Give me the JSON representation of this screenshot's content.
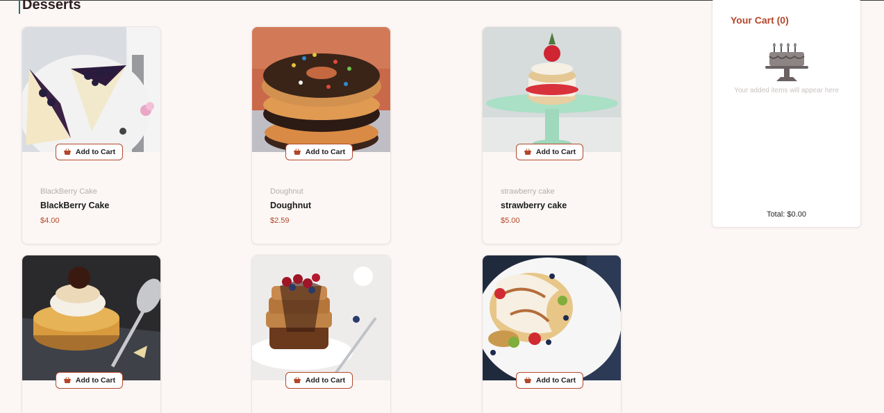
{
  "page": {
    "title": "Desserts"
  },
  "products": [
    {
      "category": "BlackBerry Cake",
      "name": "BlackBerry Cake",
      "price": "$4.00",
      "button": "Add to Cart",
      "image": "blackberry-cake"
    },
    {
      "category": "Doughnut",
      "name": "Doughnut",
      "price": "$2.59",
      "button": "Add to Cart",
      "image": "doughnut-stack"
    },
    {
      "category": "strawberry cake",
      "name": "strawberry cake",
      "price": "$5.00",
      "button": "Add to Cart",
      "image": "strawberry-shortcake"
    },
    {
      "button": "Add to Cart",
      "image": "tart-with-meringue"
    },
    {
      "button": "Add to Cart",
      "image": "waffle-stack-with-cherries"
    },
    {
      "button": "Add to Cart",
      "image": "pancakes-with-fruit"
    }
  ],
  "cart": {
    "title": "Your Cart (0)",
    "empty_message": "Your added items will appear here",
    "total": "Total: $0.00",
    "icon": "cake-icon"
  },
  "colors": {
    "accent": "#b3462a",
    "background": "#fcf7f4"
  }
}
